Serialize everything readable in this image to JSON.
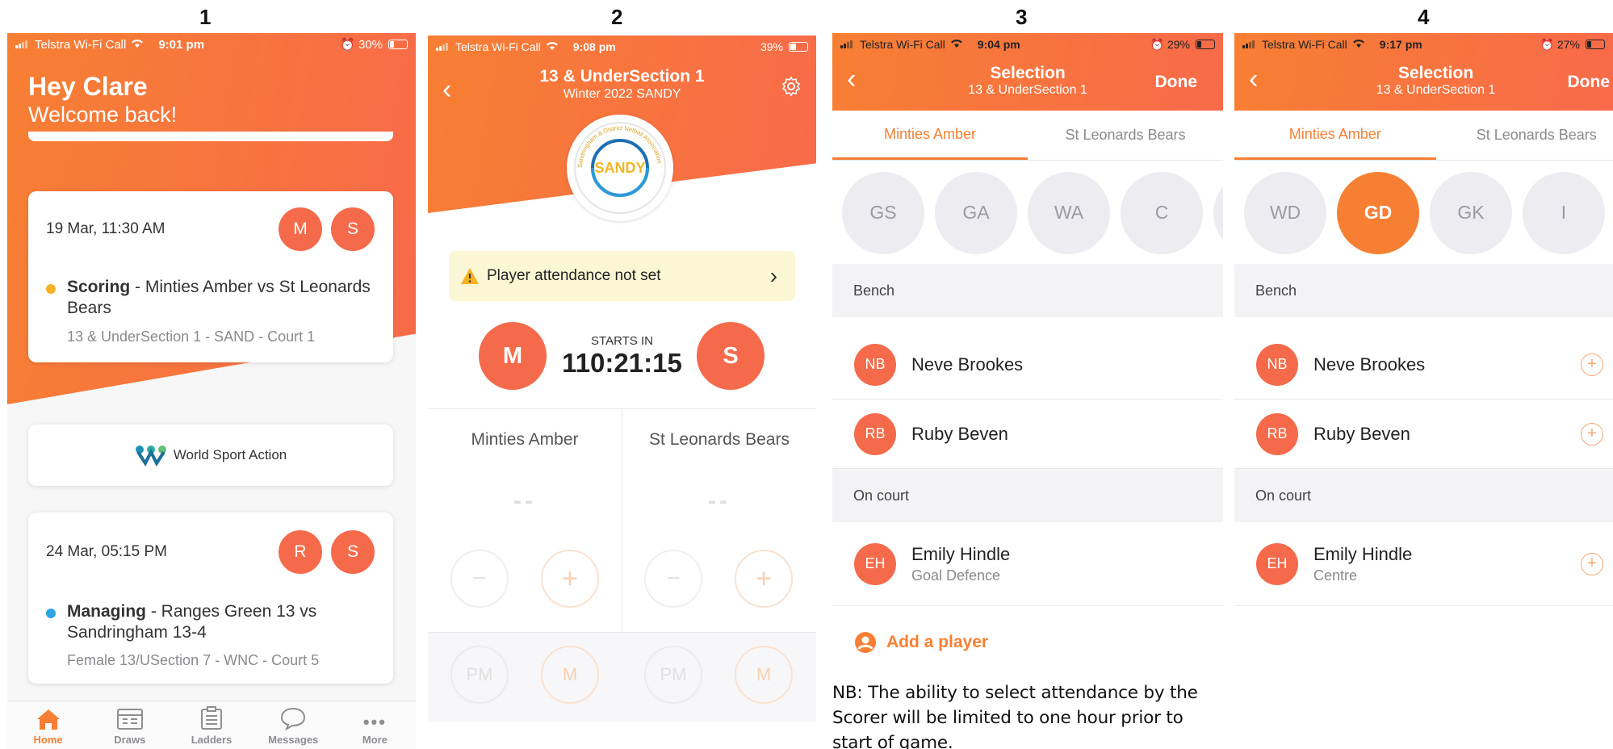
{
  "panel_labels": [
    "1",
    "2",
    "3",
    "4"
  ],
  "colors": {
    "accent": "#f77f33",
    "accent_red": "#f56a4a",
    "yellow_dot": "#f5b323",
    "blue_dot": "#2aa6e8",
    "warning_bg": "#fbf6d3"
  },
  "panel1": {
    "status": {
      "carrier": "Telstra Wi-Fi Call",
      "time": "9:01 pm",
      "battery": "30%"
    },
    "greeting": "Hey Clare",
    "welcome": "Welcome back!",
    "match1": {
      "date": "19 Mar, 11:30 AM",
      "badges": [
        "M",
        "S"
      ],
      "role": "Scoring",
      "title": " - Minties Amber vs St Leonards Bears",
      "detail": "13 & UnderSection 1 - SAND - Court 1"
    },
    "sponsor": "World Sport Action",
    "match2": {
      "date": "24 Mar, 05:15 PM",
      "badges": [
        "R",
        "S"
      ],
      "role": "Managing",
      "title": " - Ranges Green 13 vs Sandringham 13-4",
      "detail": "Female 13/USection 7 - WNC - Court 5"
    },
    "tabs": [
      "Home",
      "Draws",
      "Ladders",
      "Messages",
      "More"
    ]
  },
  "panel2": {
    "status": {
      "carrier": "Telstra Wi-Fi Call",
      "time": "9:08 pm",
      "battery": "39%"
    },
    "title": "13 & UnderSection 1",
    "subtitle": "Winter 2022 SANDY",
    "logo_text": "SANDY",
    "logo_ring_text": "Sandringham & District Netball Association",
    "attendance_warning": "Player attendance not set",
    "team_badge_left": "M",
    "team_badge_right": "S",
    "starts_in_label": "STARTS IN",
    "countdown": "110:21:15",
    "team_left": "Minties Amber",
    "team_right": "St Leonards Bears",
    "score_left": "--",
    "score_right": "--",
    "bottom_buttons": [
      "PM",
      "M",
      "PM",
      "M"
    ]
  },
  "panel3": {
    "status": {
      "carrier": "Telstra Wi-Fi Call",
      "time": "9:04 pm",
      "battery": "29%"
    },
    "title": "Selection",
    "subtitle": "13 & UnderSection 1",
    "done": "Done",
    "tabs": [
      "Minties Amber",
      "St Leonards Bears"
    ],
    "positions": [
      "GS",
      "GA",
      "WA",
      "C"
    ],
    "bench_label": "Bench",
    "bench": [
      {
        "initials": "NB",
        "name": "Neve Brookes"
      },
      {
        "initials": "RB",
        "name": "Ruby Beven"
      }
    ],
    "oncourt_label": "On court",
    "oncourt": [
      {
        "initials": "EH",
        "name": "Emily Hindle",
        "position": "Goal Defence"
      }
    ],
    "add_player": "Add a player",
    "note": "NB:  The ability to select attendance by the Scorer will be limited to one hour prior to start of game."
  },
  "panel4": {
    "status": {
      "carrier": "Telstra Wi-Fi Call",
      "time": "9:17 pm",
      "battery": "27%"
    },
    "title": "Selection",
    "subtitle": "13 & UnderSection 1",
    "done": "Done",
    "tabs": [
      "Minties Amber",
      "St Leonards Bears"
    ],
    "positions": [
      "WD",
      "GD",
      "GK",
      "I"
    ],
    "selected_position": "GD",
    "bench_label": "Bench",
    "bench": [
      {
        "initials": "NB",
        "name": "Neve Brookes"
      },
      {
        "initials": "RB",
        "name": "Ruby Beven"
      }
    ],
    "oncourt_label": "On court",
    "oncourt": [
      {
        "initials": "EH",
        "name": "Emily Hindle",
        "position": "Centre"
      }
    ]
  }
}
